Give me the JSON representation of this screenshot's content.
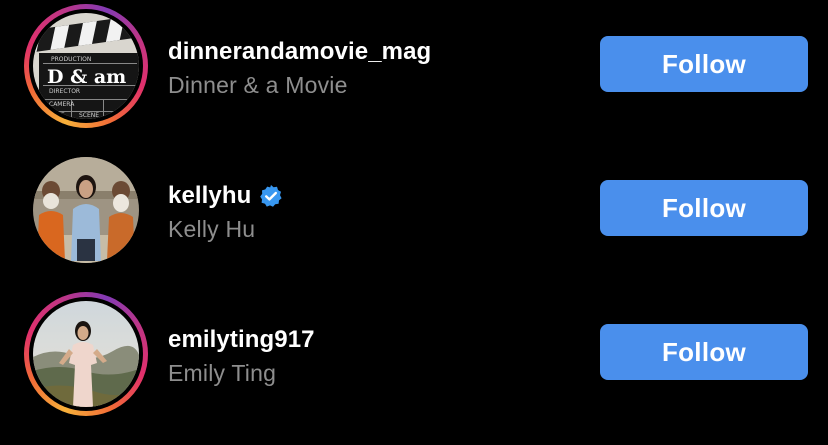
{
  "colors": {
    "background": "#000000",
    "follow_button": "#4a8fec",
    "username": "#ffffff",
    "fullname": "#8e8e8e",
    "verified_badge": "#3897f0"
  },
  "suggestions": [
    {
      "username": "dinnerandamovie_mag",
      "full_name": "Dinner & a Movie",
      "verified": false,
      "has_story_ring": true,
      "avatar_text": "D & am",
      "follow_label": "Follow"
    },
    {
      "username": "kellyhu",
      "full_name": "Kelly Hu",
      "verified": true,
      "verified_icon": "verified-badge-icon",
      "has_story_ring": false,
      "follow_label": "Follow"
    },
    {
      "username": "emilyting917",
      "full_name": "Emily Ting",
      "verified": false,
      "has_story_ring": true,
      "follow_label": "Follow"
    }
  ]
}
